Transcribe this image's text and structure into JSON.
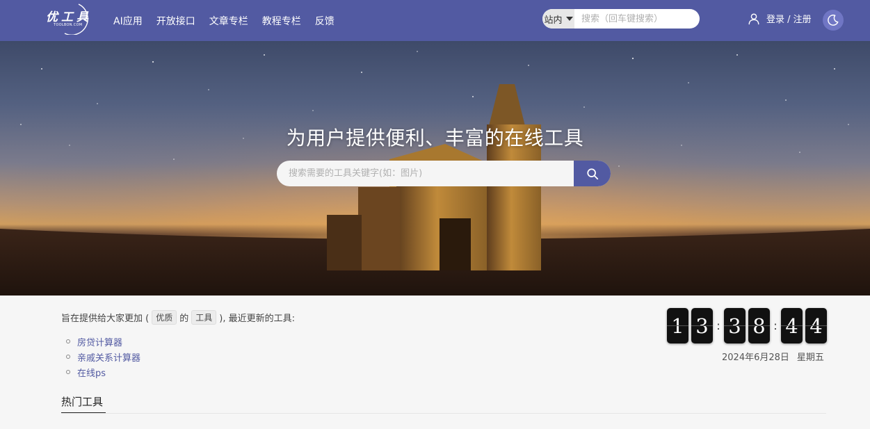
{
  "header": {
    "logo_text": "优工具",
    "logo_sub": "TOOLBON.COM",
    "nav": [
      "AI应用",
      "开放接口",
      "文章专栏",
      "教程专栏",
      "反馈"
    ],
    "search_scope": "站内",
    "search_placeholder": "搜索（回车键搜索）",
    "login_label": "登录 / 注册",
    "icons": {
      "user": "user-icon",
      "theme": "moon-icon",
      "caret": "caret-down-icon"
    }
  },
  "hero": {
    "title": "为用户提供便利、丰富的在线工具",
    "search_placeholder": "搜索需要的工具关键字(如：图片)",
    "search_icon": "search-icon"
  },
  "intro": {
    "prefix": "旨在提供给大家更加 (",
    "tag1": "优质",
    "middle": "的",
    "tag2": "工具",
    "suffix": "), 最近更新的工具:"
  },
  "recent": [
    "房贷计算器",
    "亲戚关系计算器",
    "在线ps"
  ],
  "clock": {
    "digits": [
      "1",
      "3",
      "3",
      "8",
      "4",
      "4"
    ],
    "date": "2024年6月28日",
    "weekday": "星期五"
  },
  "section": {
    "hot_tools": "热门工具"
  },
  "colors": {
    "primary": "#525aa2",
    "theme_button": "#7076c4"
  }
}
